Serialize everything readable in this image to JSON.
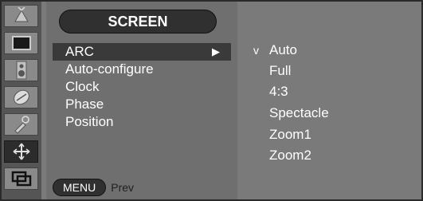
{
  "menu": {
    "title": "SCREEN",
    "items": [
      {
        "label": "ARC",
        "arrow": "▶"
      },
      {
        "label": "Auto-configure"
      },
      {
        "label": "Clock"
      },
      {
        "label": "Phase"
      },
      {
        "label": "Position"
      }
    ],
    "footer": {
      "menu_button": "MENU",
      "prev_label": "Prev"
    }
  },
  "options": [
    {
      "check": "v",
      "label": "Auto"
    },
    {
      "check": "",
      "label": "Full"
    },
    {
      "check": "",
      "label": "4:3"
    },
    {
      "check": "",
      "label": "Spectacle"
    },
    {
      "check": "",
      "label": "Zoom1"
    },
    {
      "check": "",
      "label": "Zoom2"
    }
  ],
  "icons": [
    {
      "name": "picture-adjust-icon",
      "selected": false
    },
    {
      "name": "screen-display-icon",
      "selected": false
    },
    {
      "name": "speaker-icon",
      "selected": false
    },
    {
      "name": "time-clock-icon",
      "selected": false
    },
    {
      "name": "special-settings-icon",
      "selected": false
    },
    {
      "name": "screen-adjust-icon",
      "selected": true
    },
    {
      "name": "pip-icon",
      "selected": false
    }
  ],
  "colors": {
    "panel": "#6f6f6f",
    "highlight": "#3a3a3a",
    "text": "#ffffff"
  }
}
